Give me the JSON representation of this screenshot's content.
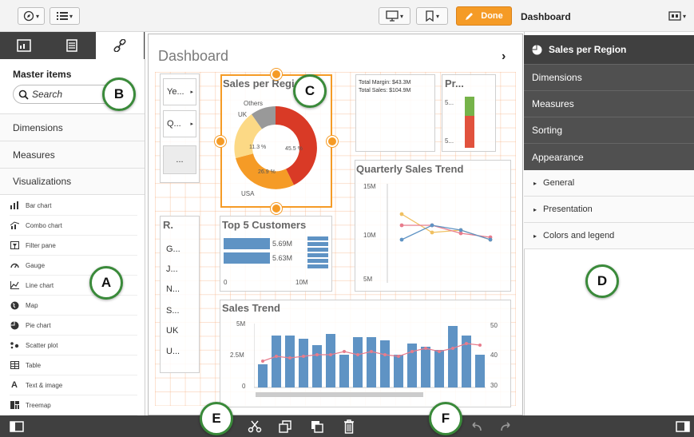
{
  "toolbar": {
    "done_label": "Done",
    "sheet_title": "Dashboard",
    "nav_icon": "compass-icon",
    "list_icon": "list-icon",
    "present_icon": "presentation-icon",
    "bookmark_icon": "bookmark-icon",
    "edit_icon": "pencil-icon",
    "sheets_icon": "sheets-icon"
  },
  "left_panel": {
    "title": "Master items",
    "search_placeholder": "Search",
    "sections": [
      "Dimensions",
      "Measures",
      "Visualizations"
    ],
    "viz_items": [
      {
        "label": "Bar chart",
        "icon": "bar-chart-icon"
      },
      {
        "label": "Combo chart",
        "icon": "combo-chart-icon"
      },
      {
        "label": "Filter pane",
        "icon": "filter-pane-icon"
      },
      {
        "label": "Gauge",
        "icon": "gauge-icon"
      },
      {
        "label": "Line chart",
        "icon": "line-chart-icon"
      },
      {
        "label": "Map",
        "icon": "map-icon"
      },
      {
        "label": "Pie chart",
        "icon": "pie-chart-icon"
      },
      {
        "label": "Scatter plot",
        "icon": "scatter-plot-icon"
      },
      {
        "label": "Table",
        "icon": "table-icon"
      },
      {
        "label": "Text & image",
        "icon": "text-image-icon"
      },
      {
        "label": "Treemap",
        "icon": "treemap-icon"
      }
    ]
  },
  "canvas": {
    "title": "Dashboard",
    "filters_top": [
      "Ye...",
      "Q...",
      "..."
    ],
    "filters_list_header": "R.",
    "filters_list": [
      "G...",
      "J...",
      "N...",
      "S...",
      "UK",
      "U..."
    ],
    "pie": {
      "title": "Sales per Region",
      "labels": [
        "Others",
        "UK",
        "11.3 %",
        "45.5 %",
        "26.9 %",
        "USA"
      ]
    },
    "kpi": {
      "line1": "Total Margin: $43.3M",
      "line2": "Total Sales: $104.9M"
    },
    "gauge": {
      "title": "Pr...",
      "label1": "5...",
      "label2": "5..."
    },
    "quarterly": {
      "title": "Quarterly Sales Trend",
      "ticks": [
        "15M",
        "10M",
        "5M"
      ]
    },
    "top5": {
      "title": "Top 5 Customers",
      "values": [
        "5.69M",
        "5.63M"
      ],
      "axis": [
        "0",
        "10M"
      ]
    },
    "sales_trend": {
      "title": "Sales Trend",
      "left_ticks": [
        "5M",
        "2.5M",
        "0"
      ],
      "right_ticks": [
        "50",
        "40",
        "30"
      ]
    }
  },
  "right_panel": {
    "header": "Sales per Region",
    "sections": [
      "Dimensions",
      "Measures",
      "Sorting",
      "Appearance"
    ],
    "sub_items": [
      "General",
      "Presentation",
      "Colors and legend"
    ]
  },
  "callouts": [
    "A",
    "B",
    "C",
    "D",
    "E",
    "F"
  ],
  "colors": {
    "accent": "#f59b26",
    "callout_border": "#3a8a3a",
    "dark_panel": "#404040"
  }
}
